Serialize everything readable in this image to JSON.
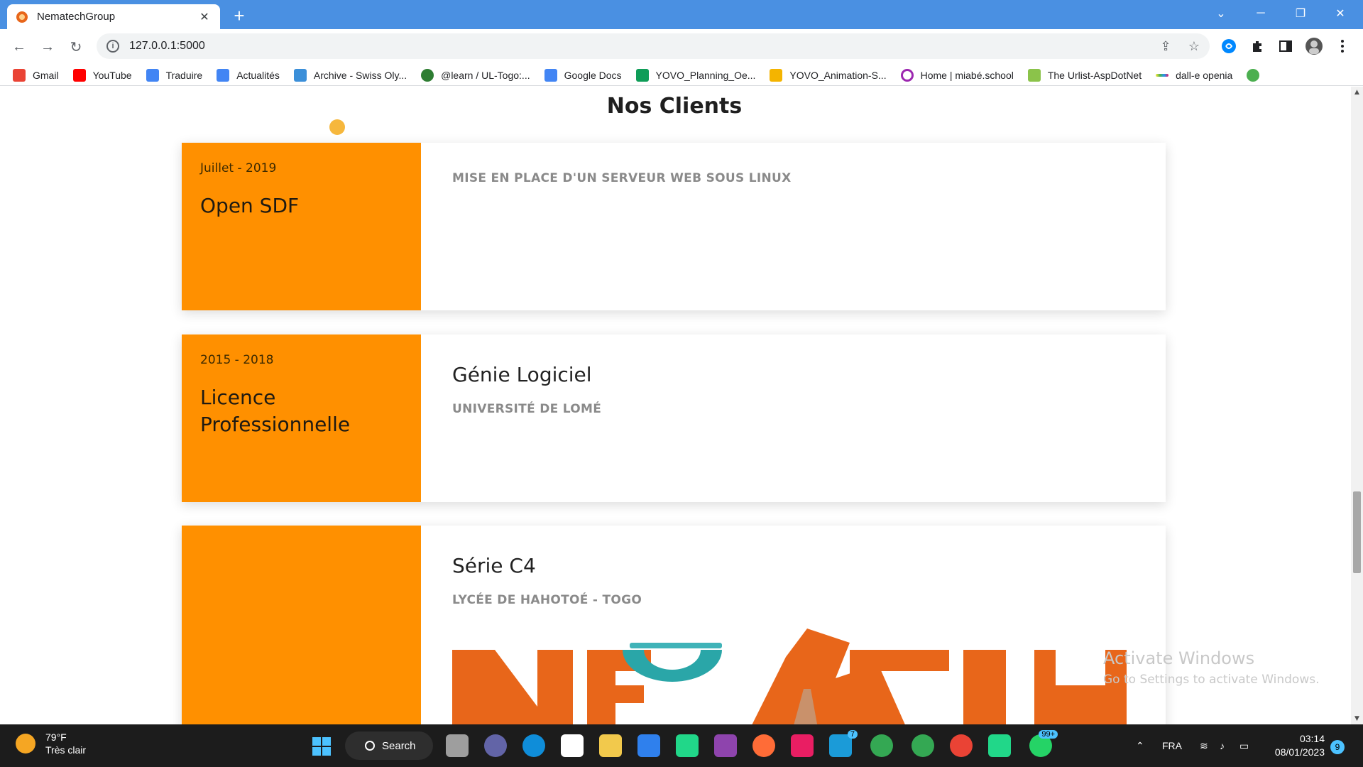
{
  "browser": {
    "tab_title": "NematechGroup",
    "url": "127.0.0.1:5000",
    "bookmarks": [
      {
        "label": "Gmail",
        "color": "#ea4335"
      },
      {
        "label": "YouTube",
        "color": "#ff0000"
      },
      {
        "label": "Traduire",
        "color": "#4285f4"
      },
      {
        "label": "Actualités",
        "color": "#4285f4"
      },
      {
        "label": "Archive - Swiss Oly...",
        "color": "#3b8fd9"
      },
      {
        "label": "@learn / UL-Togo:...",
        "color": "#2e7d32"
      },
      {
        "label": "Google Docs",
        "color": "#4285f4"
      },
      {
        "label": "YOVO_Planning_Oe...",
        "color": "#0f9d58"
      },
      {
        "label": "YOVO_Animation-S...",
        "color": "#f4b400"
      },
      {
        "label": "Home | miabé.school",
        "color": "#9c27b0"
      },
      {
        "label": "The Urlist-AspDotNet",
        "color": "#8bc34a"
      },
      {
        "label": "dall-e openia",
        "color": "#e91e63"
      }
    ]
  },
  "page": {
    "section_title": "Nos Clients",
    "cards": [
      {
        "period": "Juillet - 2019",
        "title_left": "Open SDF",
        "title_right": "",
        "subtitle": "MISE EN PLACE D'UN SERVEUR WEB SOUS LINUX"
      },
      {
        "period": "2015 - 2018",
        "title_left": "Licence Professionnelle",
        "title_right": "Génie Logiciel",
        "subtitle": "UNIVERSITÉ DE LOMÉ"
      },
      {
        "period": "",
        "title_left": "",
        "title_right": "Série C4",
        "subtitle": "LYCÉE DE HAHOTOÉ - TOGO"
      }
    ],
    "watermark_line1": "Activate Windows",
    "watermark_line2": "Go to Settings to activate Windows.",
    "accent_color": "#ff9000",
    "logo_color": "#e8661a"
  },
  "taskbar": {
    "weather_temp": "79°F",
    "weather_cond": "Très clair",
    "search_label": "Search",
    "language": "FRA",
    "time": "03:14",
    "date": "08/01/2023",
    "notification_count": "9",
    "whatsapp_badge": "99+",
    "steam_badge": "7"
  }
}
